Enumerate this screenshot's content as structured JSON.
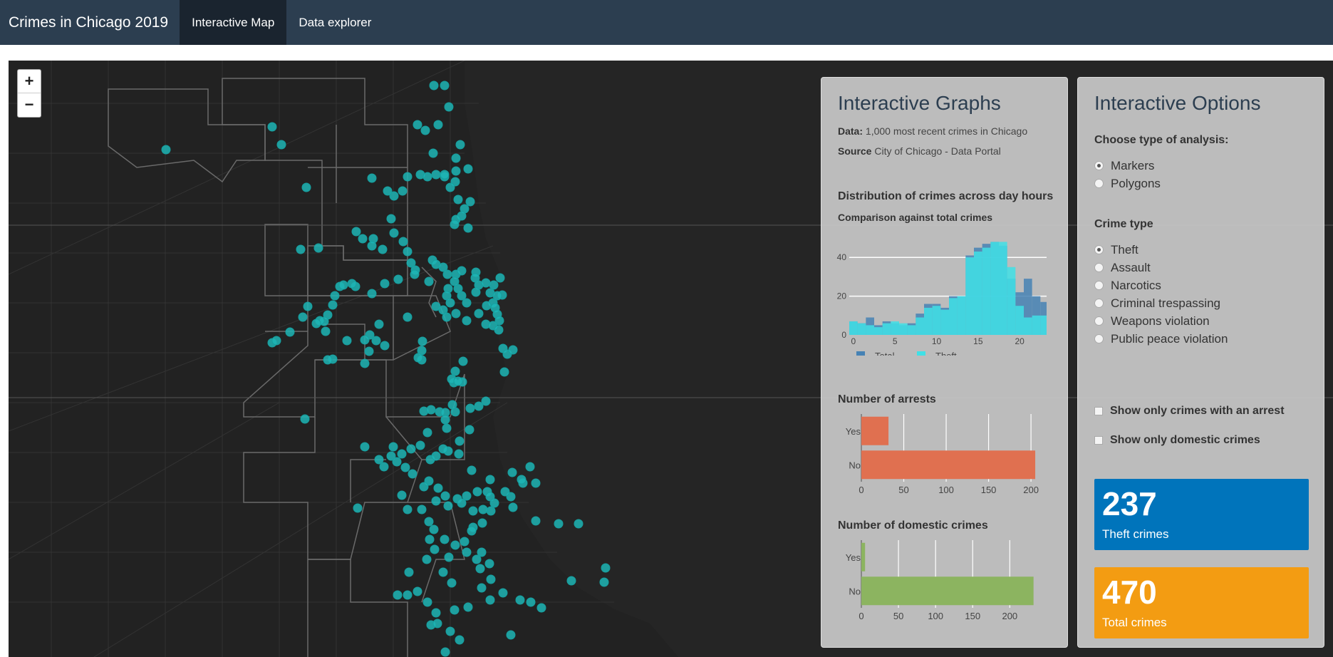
{
  "navbar": {
    "brand": "Crimes in Chicago 2019",
    "tabs": [
      {
        "label": "Interactive Map",
        "active": true
      },
      {
        "label": "Data explorer",
        "active": false
      }
    ]
  },
  "map": {
    "zoom_in": "+",
    "zoom_out": "−",
    "marker_color": "#1fb5b5"
  },
  "graphs": {
    "title": "Interactive Graphs",
    "data_label": "Data:",
    "data_text": "1,000 most recent crimes in Chicago",
    "source_label": "Source",
    "source_text": "City of Chicago - Data Portal",
    "hist_title": "Distribution of crimes across day hours",
    "hist_subtitle": "Comparison against total crimes",
    "arrests_title": "Number of arrests",
    "domestic_title": "Number of domestic crimes"
  },
  "options": {
    "title": "Interactive Options",
    "analysis_label": "Choose type of analysis:",
    "analysis_options": [
      "Markers",
      "Polygons"
    ],
    "analysis_selected": 0,
    "crime_type_label": "Crime type",
    "crime_types": [
      "Theft",
      "Assault",
      "Narcotics",
      "Criminal trespassing",
      "Weapons violation",
      "Public peace violation"
    ],
    "crime_selected": 0,
    "checkbox_arrest": "Show only crimes with an arrest",
    "checkbox_domestic": "Show only domestic crimes"
  },
  "value_boxes": [
    {
      "value": "237",
      "label": "Theft crimes",
      "color": "#0074bb"
    },
    {
      "value": "470",
      "label": "Total crimes",
      "color": "#f39c12"
    }
  ],
  "chart_data": [
    {
      "type": "bar",
      "title": "Distribution of crimes across day hours",
      "subtitle": "Comparison against total crimes",
      "x": [
        0,
        1,
        2,
        3,
        4,
        5,
        6,
        7,
        8,
        9,
        10,
        11,
        12,
        13,
        14,
        15,
        16,
        17,
        18,
        19,
        20,
        21,
        22,
        23
      ],
      "series": [
        {
          "name": "Total",
          "color": "#4682b4",
          "values": [
            7,
            6,
            9,
            5,
            7,
            6,
            5,
            6,
            11,
            16,
            16,
            14,
            20,
            20,
            41,
            45,
            47,
            48,
            46,
            29,
            22,
            29,
            20,
            17
          ]
        },
        {
          "name": "Theft",
          "color": "#40e0e6",
          "values": [
            7,
            6,
            5,
            4,
            6,
            7,
            6,
            5,
            9,
            14,
            15,
            13,
            19,
            20,
            40,
            43,
            45,
            48,
            48,
            35,
            15,
            9,
            10,
            10
          ]
        }
      ],
      "xticks": [
        0,
        5,
        10,
        15,
        20
      ],
      "yticks": [
        0,
        20,
        40
      ],
      "ylim": [
        0,
        50
      ],
      "legend": "bottom"
    },
    {
      "type": "bar",
      "orientation": "horizontal",
      "title": "Number of arrests",
      "categories": [
        "Yes",
        "No"
      ],
      "values": [
        32,
        205
      ],
      "color": "#e07050",
      "xticks": [
        0,
        50,
        100,
        150,
        200
      ],
      "xlim": [
        0,
        210
      ]
    },
    {
      "type": "bar",
      "orientation": "horizontal",
      "title": "Number of domestic crimes",
      "categories": [
        "Yes",
        "No"
      ],
      "values": [
        5,
        232
      ],
      "color": "#8cb460",
      "xticks": [
        0,
        50,
        100,
        150,
        200
      ],
      "xlim": [
        0,
        240
      ]
    }
  ]
}
